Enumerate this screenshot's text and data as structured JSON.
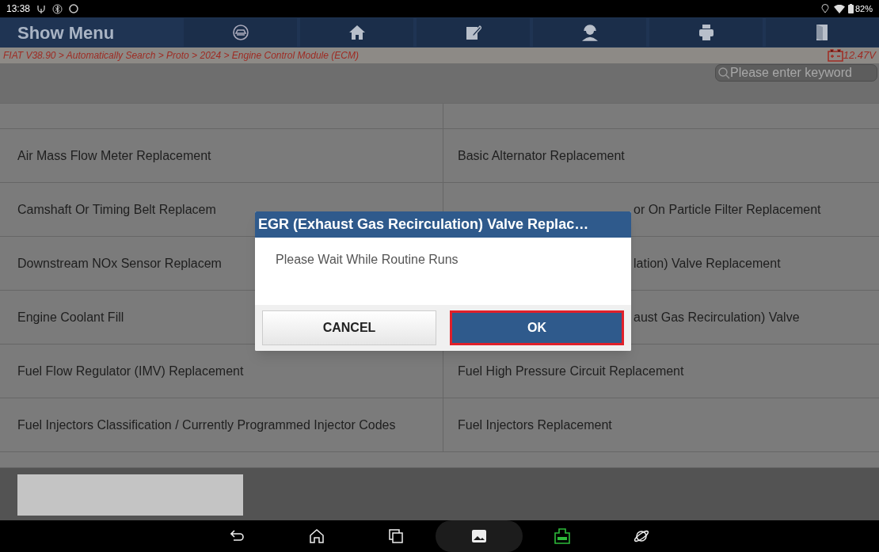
{
  "status_bar": {
    "time": "13:38",
    "battery": "82%"
  },
  "header": {
    "title": "Show Menu"
  },
  "breadcrumb": "FIAT V38.90 > Automatically Search > Proto > 2024 > Engine Control Module (ECM)",
  "voltage": "12.47V",
  "search": {
    "placeholder": "Please enter keyword"
  },
  "menu_rows": [
    [
      "Air Mass Flow Meter Replacement",
      "Basic Alternator Replacement"
    ],
    [
      "Camshaft Or Timing Belt Replacem",
      "or On Particle Filter Replacement"
    ],
    [
      "Downstream NOx Sensor Replacem",
      "lation) Valve Replacement"
    ],
    [
      "Engine Coolant Fill",
      "aust Gas Recirculation) Valve"
    ],
    [
      "Fuel Flow Regulator (IMV) Replacement",
      "Fuel High Pressure Circuit Replacement"
    ],
    [
      "Fuel Injectors Classification / Currently Programmed Injector Codes",
      "Fuel Injectors Replacement"
    ]
  ],
  "dialog": {
    "title": "EGR (Exhaust Gas Recirculation) Valve Replac…",
    "message": "Please Wait While Routine Runs",
    "buttons": [
      {
        "label": "CANCEL",
        "kind": "secondary",
        "focused": false
      },
      {
        "label": "OK",
        "kind": "primary",
        "focused": true
      }
    ]
  }
}
